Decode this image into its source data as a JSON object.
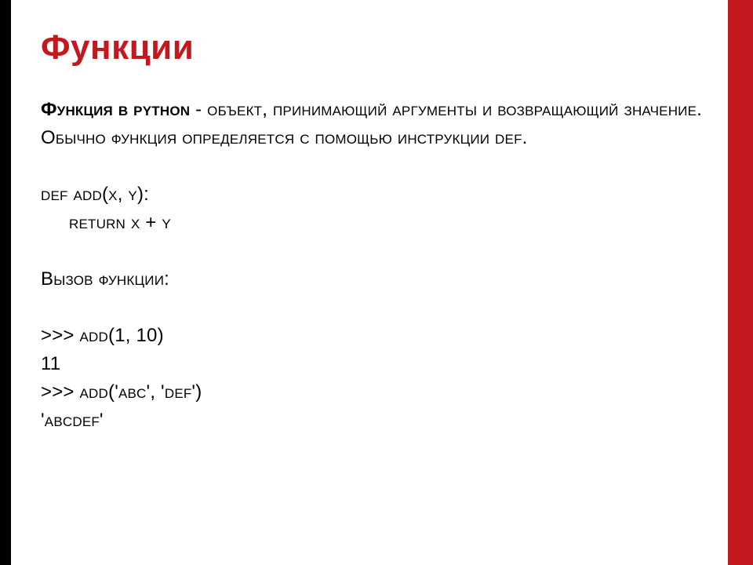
{
  "slide": {
    "title": "Функции",
    "lead_label": "Функция в python",
    "lead_rest": " - объект, принимающий аргументы и возвращающий значение.",
    "def_stmt": "Обычно функция определяется с помощью инструкции def.",
    "code": {
      "def_line": "def add(x, y):",
      "return_line": "return x + y"
    },
    "call_header": "Вызов функции:",
    "repl": {
      "line1": ">>> add(1, 10)",
      "res1": "11",
      "line2": ">>> add('abc', 'def')",
      "res2": "'abcdef'"
    }
  },
  "colors": {
    "accent": "#c5171e",
    "left_bar": "#000000",
    "background": "#ffffff"
  }
}
